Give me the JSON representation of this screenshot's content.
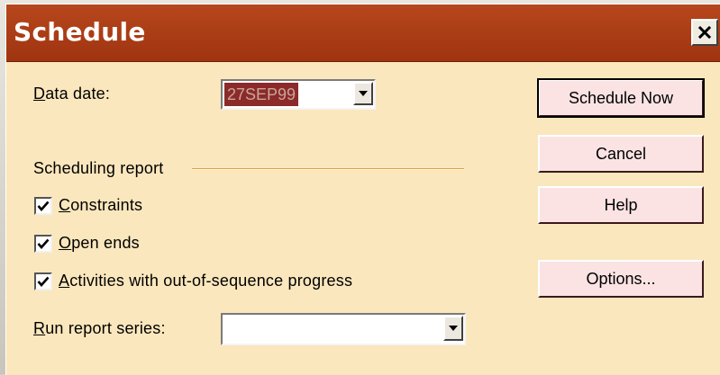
{
  "window": {
    "title": "Schedule",
    "close_icon": "close-icon"
  },
  "data_date": {
    "label_underline": "D",
    "label_rest": "ata date:",
    "value": "27SEP99"
  },
  "scheduling_report": {
    "heading": "Scheduling report",
    "checkboxes": [
      {
        "underline": "C",
        "rest": "onstraints",
        "checked": true
      },
      {
        "underline": "O",
        "rest": "pen ends",
        "checked": true
      },
      {
        "underline": "A",
        "rest": "ctivities with out-of-sequence progress",
        "checked": true
      }
    ]
  },
  "run_report": {
    "label_underline": "R",
    "label_rest": "un report series:",
    "value": ""
  },
  "buttons": {
    "schedule_now": "Schedule Now",
    "cancel": "Cancel",
    "help": "Help",
    "options": "Options..."
  },
  "colors": {
    "titlebar": "#a83c14",
    "dialog_bg": "#fbe7bd",
    "button_bg": "#fbe3e4",
    "selection": "#8c2a2a"
  }
}
